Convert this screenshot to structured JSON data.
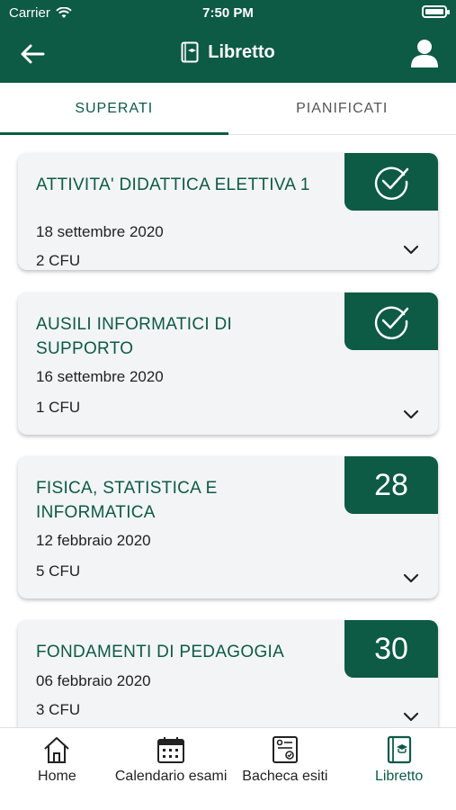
{
  "status": {
    "carrier": "Carrier",
    "time": "7:50 PM"
  },
  "header": {
    "title": "Libretto",
    "icons": [
      "back-arrow-icon",
      "book-icon",
      "profile-icon"
    ]
  },
  "tabs": [
    {
      "label": "SUPERATI",
      "active": true
    },
    {
      "label": "PIANIFICATI",
      "active": false
    }
  ],
  "exams": [
    {
      "name": "ATTIVITA' DIDATTICA ELETTIVA 1",
      "date": "18 settembre 2020",
      "cfu": "2 CFU",
      "grade": "",
      "badge_icon": "check-circle-icon"
    },
    {
      "name": "AUSILI INFORMATICI DI SUPPORTO",
      "date": "16 settembre 2020",
      "cfu": "1 CFU",
      "grade": "",
      "badge_icon": "check-circle-icon"
    },
    {
      "name": "FISICA, STATISTICA E INFORMATICA",
      "date": "12 febbraio 2020",
      "cfu": "5 CFU",
      "grade": "28",
      "badge_icon": ""
    },
    {
      "name": "FONDAMENTI DI PEDAGOGIA",
      "date": "06 febbraio 2020",
      "cfu": "3 CFU",
      "grade": "30",
      "badge_icon": ""
    }
  ],
  "bottom_nav": [
    {
      "label": "Home",
      "icon": "home-icon",
      "active": false
    },
    {
      "label": "Calendario esami",
      "icon": "calendar-icon",
      "active": false
    },
    {
      "label": "Bacheca esiti",
      "icon": "results-board-icon",
      "active": false
    },
    {
      "label": "Libretto",
      "icon": "book-icon",
      "active": true
    }
  ],
  "colors": {
    "primary": "#0d5a45",
    "card_bg": "#f3f4f6"
  }
}
